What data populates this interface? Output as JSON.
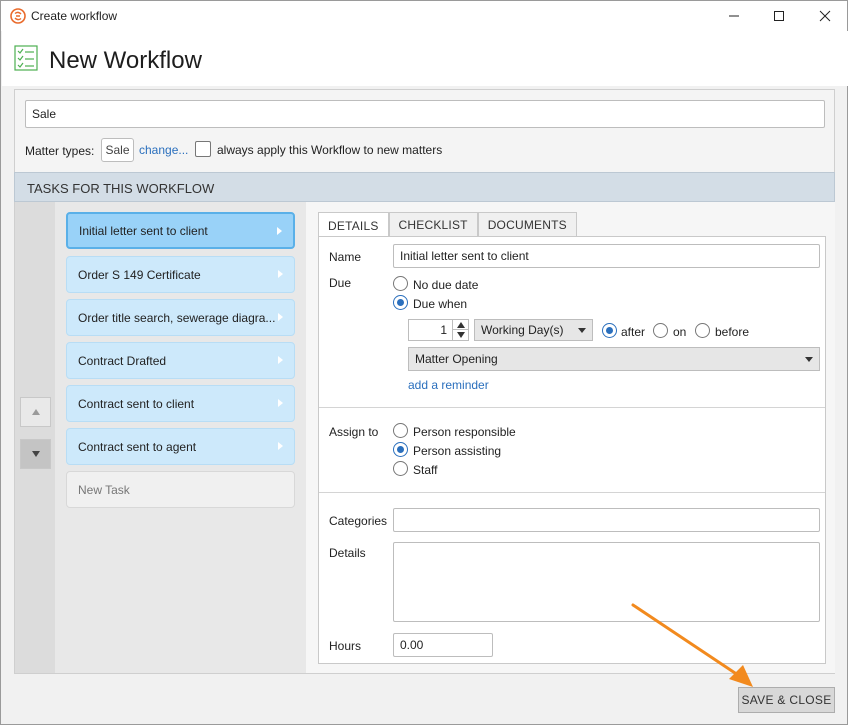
{
  "window": {
    "title": "Create workflow",
    "icon": "app-logo-icon",
    "controls": [
      "minimize-icon",
      "maximize-icon",
      "close-icon"
    ]
  },
  "header": {
    "icon": "checklist-icon",
    "title": "New Workflow"
  },
  "workflow": {
    "name_value": "Sale",
    "matter_types_label": "Matter types:",
    "matter_type_chip": "Sale",
    "change_link": "change...",
    "always_apply_label": "always apply this Workflow to new matters",
    "always_apply_checked": false
  },
  "tasks_section": {
    "header": "TASKS FOR THIS WORKFLOW",
    "move_up_icon": "triangle-up-icon",
    "move_down_icon": "triangle-down-icon",
    "tasks": [
      {
        "label": "Initial letter sent to client",
        "selected": true
      },
      {
        "label": "Order S 149 Certificate",
        "selected": false
      },
      {
        "label": "Order title search, sewerage diagra...",
        "selected": false
      },
      {
        "label": "Contract Drafted",
        "selected": false
      },
      {
        "label": "Contract sent to client",
        "selected": false
      },
      {
        "label": "Contract sent to agent",
        "selected": false
      }
    ],
    "new_task_placeholder": "New Task"
  },
  "details": {
    "tabs": [
      {
        "label": "DETAILS",
        "active": true
      },
      {
        "label": "CHECKLIST",
        "active": false
      },
      {
        "label": "DOCUMENTS",
        "active": false
      }
    ],
    "name_label": "Name",
    "name_value": "Initial letter sent to client",
    "due_label": "Due",
    "due_options": [
      {
        "label": "No due date",
        "selected": false
      },
      {
        "label": "Due when",
        "selected": true
      }
    ],
    "due_amount": "1",
    "due_unit": "Working Day(s)",
    "relation_options": [
      {
        "label": "after",
        "selected": true
      },
      {
        "label": "on",
        "selected": false
      },
      {
        "label": "before",
        "selected": false
      }
    ],
    "due_event": "Matter Opening",
    "add_reminder_link": "add a reminder",
    "assign_label": "Assign to",
    "assign_options": [
      {
        "label": "Person responsible",
        "selected": false
      },
      {
        "label": "Person assisting",
        "selected": true
      },
      {
        "label": "Staff",
        "selected": false
      }
    ],
    "categories_label": "Categories",
    "categories_value": "",
    "details_label": "Details",
    "details_value": "",
    "hours_label": "Hours",
    "hours_value": "0.00"
  },
  "footer": {
    "save_close_label": "SAVE & CLOSE"
  },
  "colors": {
    "accent": "#2a6fbd",
    "task_selected": "#99d2f8",
    "task_normal": "#cde9fb",
    "annotation_arrow": "#f28a1e"
  }
}
